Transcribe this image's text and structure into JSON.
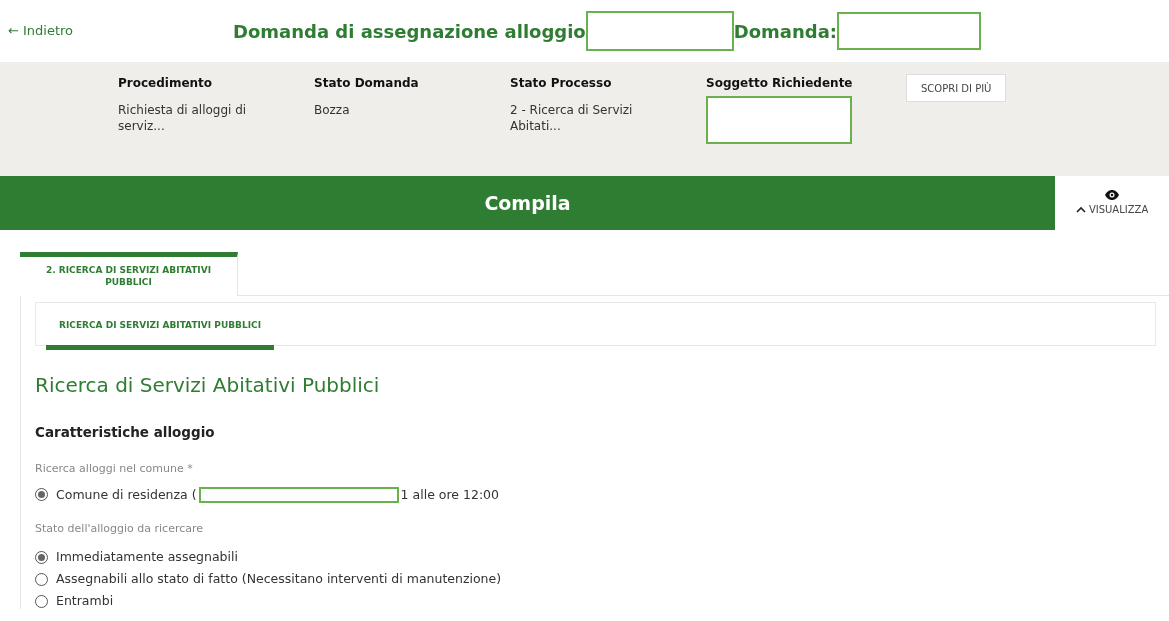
{
  "header": {
    "back_link": "← Indietro",
    "title": "Domanda di assegnazione alloggio",
    "domanda_label": "Domanda:"
  },
  "summary": {
    "fields": [
      {
        "label": "Procedimento",
        "value": "Richiesta di alloggi di serviz...",
        "redacted": false
      },
      {
        "label": "Stato Domanda",
        "value": "Bozza",
        "redacted": false
      },
      {
        "label": "Stato Processo",
        "value": "2 - Ricerca di Servizi Abitati...",
        "redacted": false
      },
      {
        "label": "Soggetto Richiedente",
        "redacted": true
      }
    ],
    "button": "SCOPRI DI PIÙ"
  },
  "action_bar": {
    "title": "Compila",
    "toggle": "VISUALIZZA",
    "expanded": true
  },
  "tabs": [
    {
      "label": "2. RICERCA DI SERVIZI ABITATIVI PUBBLICI",
      "selected": true
    }
  ],
  "subtabs": [
    {
      "label": "RICERCA DI SERVIZI ABITATIVI PUBBLICI",
      "selected": true
    }
  ],
  "section_title": "Ricerca di Servizi Abitativi Pubblici",
  "subsection_title": "Caratteristiche alloggio",
  "groups": [
    {
      "label": "Ricerca alloggi nel comune *",
      "options": [
        {
          "text_before": "Comune di residenza (",
          "text_after": "1 alle ore 12:00",
          "redacted": true,
          "selected": true
        }
      ]
    },
    {
      "label": "Stato dell'alloggio da ricercare",
      "options": [
        {
          "text_before": "Immediatamente assegnabili",
          "redacted": false,
          "selected": true
        },
        {
          "text_before": "Assegnabili allo stato di fatto (Necessitano interventi di manutenzione)",
          "redacted": false,
          "selected": false
        },
        {
          "text_before": "Entrambi",
          "redacted": false,
          "selected": false
        }
      ]
    }
  ]
}
